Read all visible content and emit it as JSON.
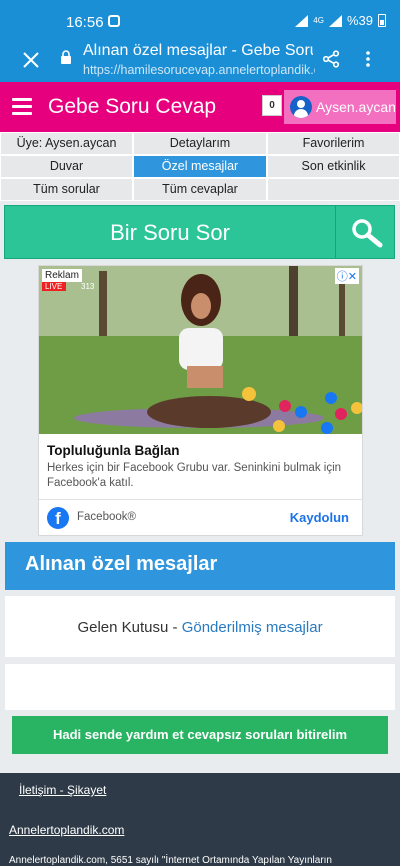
{
  "status": {
    "time": "16:56",
    "network": "4G",
    "battery": "%39"
  },
  "browser": {
    "title": "Alınan özel mesajlar - Gebe Soru Cevap",
    "url": "https://hamilesorucevap.annelertoplandik.com"
  },
  "header": {
    "site_title": "Gebe Soru Cevap",
    "notification_count": "0",
    "username": "Aysen.aycan",
    "brand_color": "#e6007e"
  },
  "nav": {
    "items": [
      "Üye: Aysen.aycan",
      "Detaylarım",
      "Favorilerim",
      "Duvar",
      "Özel mesajlar",
      "Son etkinlik",
      "Tüm sorular",
      "Tüm cevaplar",
      ""
    ],
    "active_index": 4
  },
  "ask": {
    "label": "Bir Soru Sor"
  },
  "ad": {
    "badge": "Reklam",
    "heading": "Topluluğunla Bağlan",
    "description": "Herkes için bir Facebook Grubu var. Seninkini bulmak için Facebook'a katıl.",
    "brand": "Facebook®",
    "cta": "Kaydolun",
    "live_label": "LIVE",
    "viewers": "313"
  },
  "section": {
    "title": "Alınan özel mesajlar",
    "inbox_label": "Gelen Kutusu",
    "separator": "-",
    "sent_link": "Gönderilmiş mesajlar"
  },
  "help_button": "Hadi sende yardım et cevapsız soruları bitirelim",
  "footer": {
    "contact": "İletişim - Şikayet",
    "site": "Annelertoplandik.com",
    "note": "Annelertoplandik.com, 5651 sayılı \"İnternet Ortamında Yapılan Yayınların"
  }
}
